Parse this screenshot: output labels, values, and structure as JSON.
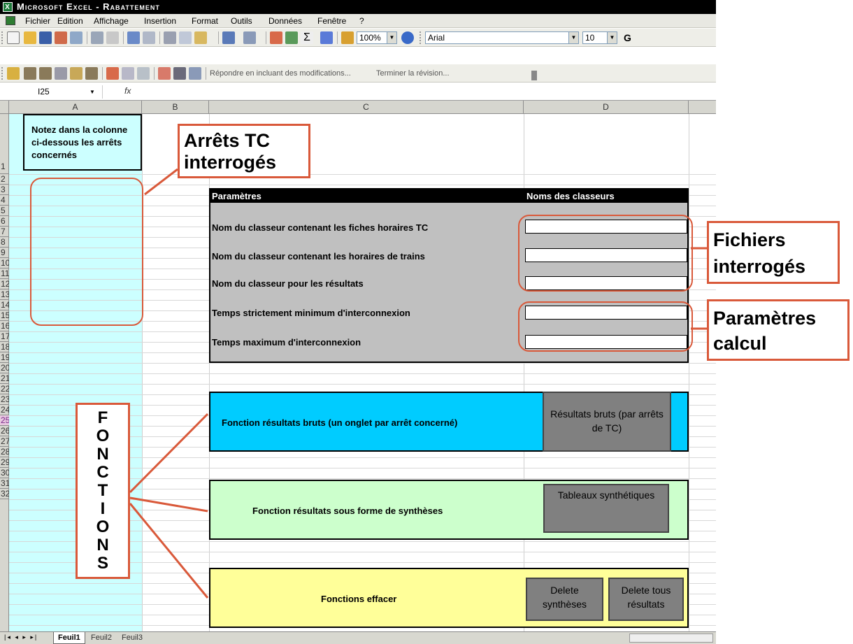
{
  "window": {
    "title": "Microsoft Excel - Rabattement",
    "app_icon": "excel-icon"
  },
  "menu": [
    "Fichier",
    "Edition",
    "Affichage",
    "Insertion",
    "Format",
    "Outils",
    "Données",
    "Fenêtre",
    "?"
  ],
  "toolbar": {
    "zoom": "100%",
    "font_name": "Arial",
    "font_size": "10",
    "bold_label": "G",
    "reply_label": "Répondre en incluant des modifications...",
    "end_review_label": "Terminer la révision..."
  },
  "formula_bar": {
    "cell_ref": "I25",
    "fx": "fx",
    "value": ""
  },
  "columns": [
    "A",
    "B",
    "C",
    "D"
  ],
  "rows": [
    "1",
    "2",
    "3",
    "4",
    "5",
    "6",
    "7",
    "8",
    "9",
    "10",
    "11",
    "12",
    "13",
    "14",
    "15",
    "16",
    "17",
    "18",
    "19",
    "20",
    "21",
    "22",
    "23",
    "24",
    "25",
    "26",
    "27",
    "28",
    "29",
    "30",
    "31",
    "32"
  ],
  "selected_row": "25",
  "sheet": {
    "a1_note": "Notez dans la colonne ci-dessous les arrêts concernés",
    "params_header": "Paramètres",
    "classeurs_header": "Noms des classeurs",
    "params": [
      "Nom du classeur contenant les fiches horaires TC",
      "Nom du classeur contenant les horaires de trains",
      "Nom du classeur pour les résultats",
      "Temps strictement minimum d'interconnexion",
      "Temps maximum d'interconnexion"
    ],
    "fn_bruts_label": "Fonction résultats bruts (un onglet par arrêt concerné)",
    "fn_bruts_button": "Résultats bruts (par arrêts de TC)",
    "fn_synth_label": "Fonction résultats sous forme de synthèses",
    "fn_synth_button": "Tableaux synthétiques",
    "fn_effacer_label": "Fonctions effacer",
    "delete_synth_button": "Delete synthèses",
    "delete_all_button": "Delete tous résultats"
  },
  "callouts": {
    "arrets": "Arrêts TC interrogés",
    "fichiers": "Fichiers interrogés",
    "parametres": "Paramètres calcul",
    "fonctions": [
      "F",
      "O",
      "N",
      "C",
      "T",
      "I",
      "O",
      "N",
      "S"
    ]
  },
  "sheet_tabs": [
    "Feuil1",
    "Feuil2",
    "Feuil3"
  ],
  "colors": {
    "col_a_fill": "#ccffff",
    "params_fill": "#c0c0c0",
    "bruts_fill": "#00ccff",
    "synth_fill": "#ccffcc",
    "effacer_fill": "#ffff99",
    "callout_border": "#d9593a"
  }
}
